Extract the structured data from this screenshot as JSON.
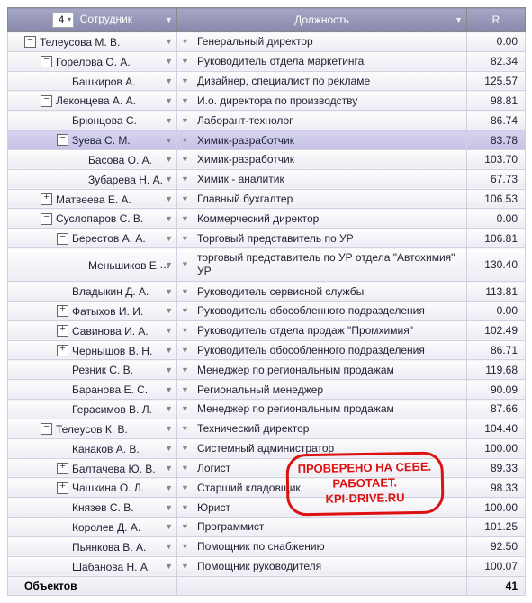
{
  "columns": {
    "employee": "Сотрудник",
    "position": "Должность",
    "r": "R"
  },
  "page_selector": "4",
  "rows": [
    {
      "indent": 0,
      "tree": "minus",
      "name": "Телеусова М. В.",
      "position": "Генеральный директор",
      "r": "0.00",
      "hl": false
    },
    {
      "indent": 1,
      "tree": "minus",
      "name": "Горелова О. А.",
      "position": "Руководитель отдела маркетинга",
      "r": "82.34",
      "hl": false
    },
    {
      "indent": 2,
      "tree": "",
      "name": "Башкиров А.",
      "position": "Дизайнер, специалист по рекламе",
      "r": "125.57",
      "hl": false
    },
    {
      "indent": 1,
      "tree": "minus",
      "name": "Леконцева А. А.",
      "position": "И.о. директора по производству",
      "r": "98.81",
      "hl": false
    },
    {
      "indent": 2,
      "tree": "",
      "name": "Брюнцова С.",
      "position": "Лаборант-технолог",
      "r": "86.74",
      "hl": false
    },
    {
      "indent": 2,
      "tree": "minus",
      "name": "Зуева С. М.",
      "position": "Химик-разработчик",
      "r": "83.78",
      "hl": true
    },
    {
      "indent": 3,
      "tree": "",
      "name": "Басова О. А.",
      "position": "Химик-разработчик",
      "r": "103.70",
      "hl": false
    },
    {
      "indent": 3,
      "tree": "",
      "name": "Зубарева Н. А.",
      "position": "Химик - аналитик",
      "r": "67.73",
      "hl": false
    },
    {
      "indent": 1,
      "tree": "plus",
      "name": "Матвеева Е. А.",
      "position": "Главный бухгалтер",
      "r": "106.53",
      "hl": false
    },
    {
      "indent": 1,
      "tree": "minus",
      "name": "Суслопаров С. В.",
      "position": "Коммерческий директор",
      "r": "0.00",
      "hl": false
    },
    {
      "indent": 2,
      "tree": "minus",
      "name": "Берестов А. А.",
      "position": "Торговый представитель по УР",
      "r": "106.81",
      "hl": false
    },
    {
      "indent": 3,
      "tree": "",
      "name": "Меньшиков Е. Н.",
      "position": "торговый представитель по УР отдела \"Автохимия\" УР",
      "r": "130.40",
      "hl": false,
      "wrap": true
    },
    {
      "indent": 2,
      "tree": "",
      "name": "Владыкин Д. А.",
      "position": "Руководитель сервисной службы",
      "r": "113.81",
      "hl": false
    },
    {
      "indent": 2,
      "tree": "plus",
      "name": "Фатыхов И. И.",
      "position": "Руководитель обособленного подразделения",
      "r": "0.00",
      "hl": false
    },
    {
      "indent": 2,
      "tree": "plus",
      "name": "Савинова И. А.",
      "position": "Руководитель отдела продаж \"Промхимия\"",
      "r": "102.49",
      "hl": false
    },
    {
      "indent": 2,
      "tree": "plus",
      "name": "Чернышов В. Н.",
      "position": "Руководитель обособленного подразделения",
      "r": "86.71",
      "hl": false
    },
    {
      "indent": 2,
      "tree": "",
      "name": "Резник С. В.",
      "position": "Менеджер по региональным продажам",
      "r": "119.68",
      "hl": false
    },
    {
      "indent": 2,
      "tree": "",
      "name": "Баранова Е. С.",
      "position": "Региональный менеджер",
      "r": "90.09",
      "hl": false
    },
    {
      "indent": 2,
      "tree": "",
      "name": "Герасимов В. Л.",
      "position": "Менеджер по региональным продажам",
      "r": "87.66",
      "hl": false
    },
    {
      "indent": 1,
      "tree": "minus",
      "name": "Телеусов К. В.",
      "position": "Технический директор",
      "r": "104.40",
      "hl": false
    },
    {
      "indent": 2,
      "tree": "",
      "name": "Канаков А. В.",
      "position": "Системный администратор",
      "r": "100.00",
      "hl": false
    },
    {
      "indent": 2,
      "tree": "plus",
      "name": "Балтачева Ю. В.",
      "position": "Логист",
      "r": "89.33",
      "hl": false
    },
    {
      "indent": 2,
      "tree": "plus",
      "name": "Чашкина О. Л.",
      "position": "Старший кладовщик",
      "r": "98.33",
      "hl": false
    },
    {
      "indent": 2,
      "tree": "",
      "name": "Князев С. В.",
      "position": "Юрист",
      "r": "100.00",
      "hl": false
    },
    {
      "indent": 2,
      "tree": "",
      "name": "Королев Д. А.",
      "position": "Программист",
      "r": "101.25",
      "hl": false
    },
    {
      "indent": 2,
      "tree": "",
      "name": "Пьянкова В. А.",
      "position": "Помощник по снабжению",
      "r": "92.50",
      "hl": false
    },
    {
      "indent": 2,
      "tree": "",
      "name": "Шабанова Н. А.",
      "position": "Помощник руководителя",
      "r": "100.07",
      "hl": false
    }
  ],
  "footer": {
    "label": "Объектов",
    "count": "41"
  },
  "stamp": {
    "line1": "ПРОВЕРЕНО НА СЕБЕ.",
    "line2": "РАБОТАЕТ.",
    "line3": "KPI-DRIVE.RU"
  }
}
